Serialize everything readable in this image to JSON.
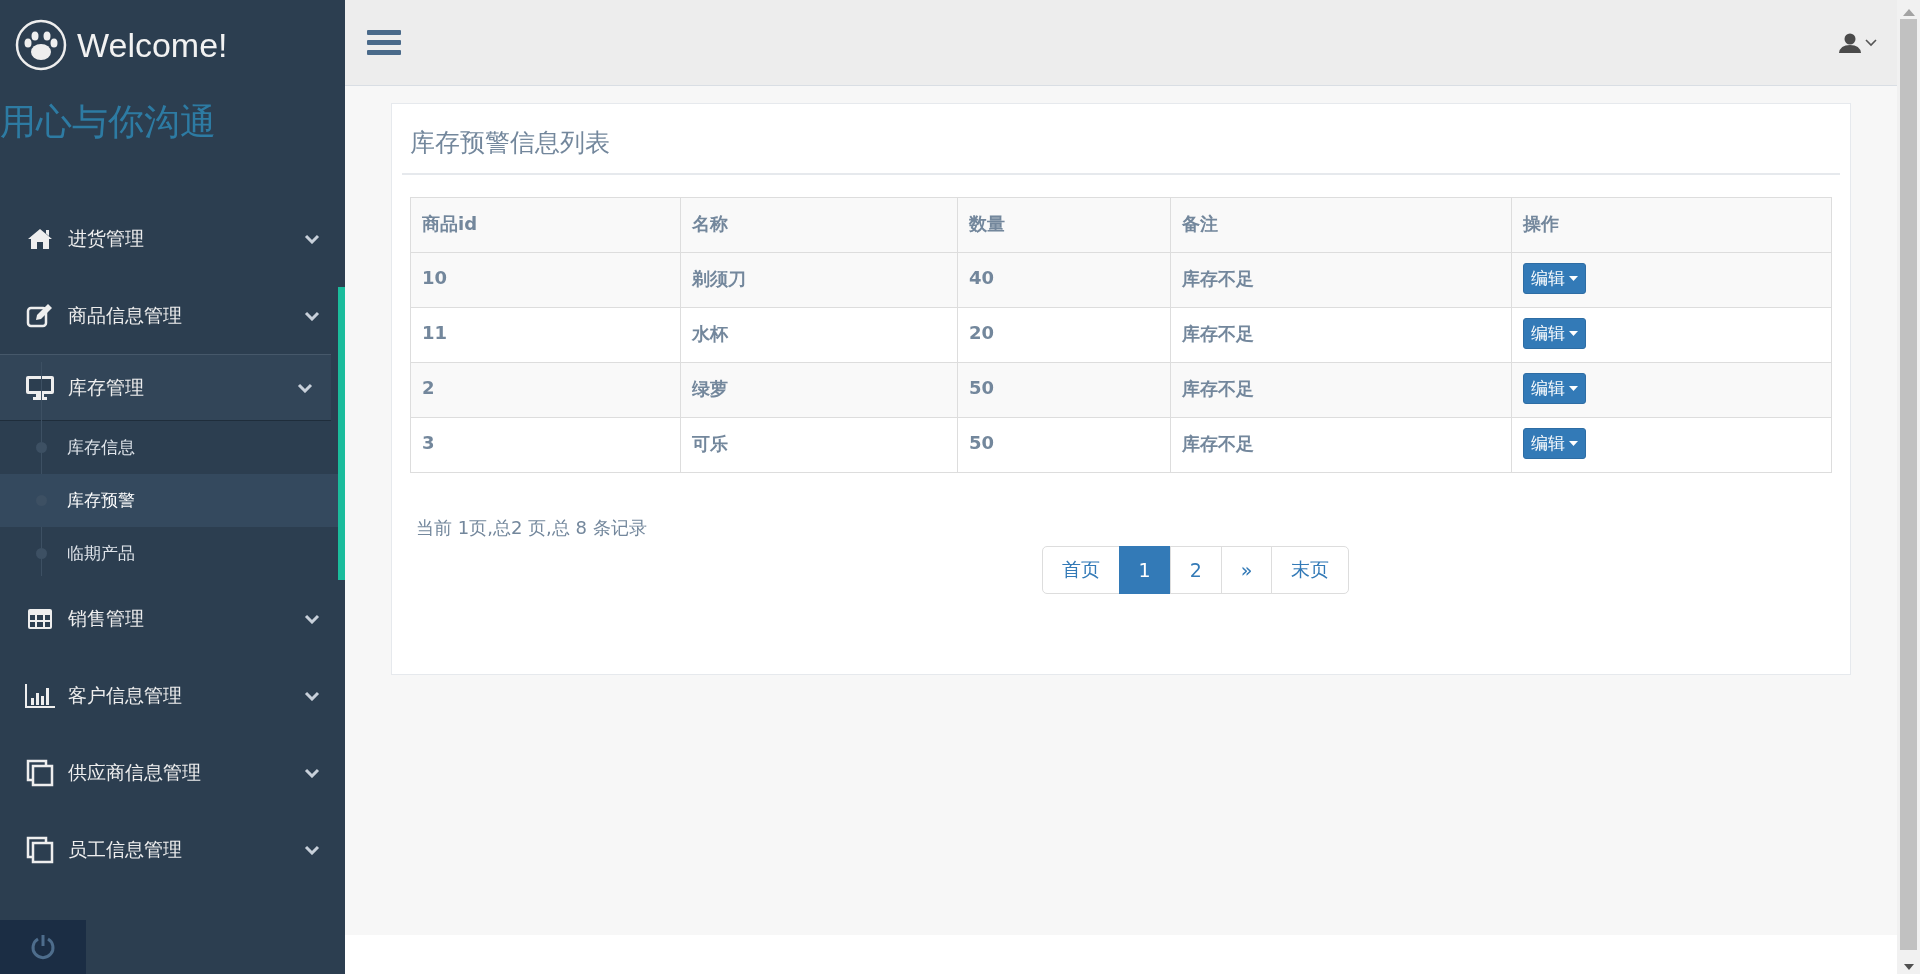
{
  "sidebar": {
    "brand": "Welcome!",
    "slogan": "用心与你沟通",
    "items": [
      {
        "label": "进货管理",
        "expanded": false
      },
      {
        "label": "商品信息管理",
        "expanded": false
      },
      {
        "label": "库存管理",
        "expanded": true,
        "children": [
          {
            "label": "库存信息",
            "selected": false
          },
          {
            "label": "库存预警",
            "selected": true
          },
          {
            "label": "临期产品",
            "selected": false
          }
        ]
      },
      {
        "label": "销售管理",
        "expanded": false
      },
      {
        "label": "客户信息管理",
        "expanded": false
      },
      {
        "label": "供应商信息管理",
        "expanded": false
      },
      {
        "label": "员工信息管理",
        "expanded": false
      }
    ]
  },
  "panel": {
    "title": "库存预警信息列表",
    "table": {
      "columns": [
        "商品id",
        "名称",
        "数量",
        "备注",
        "操作"
      ],
      "rows": [
        {
          "cells": [
            "10",
            "剃须刀",
            "40",
            "库存不足"
          ],
          "action": "编辑"
        },
        {
          "cells": [
            "11",
            "水杯",
            "20",
            "库存不足"
          ],
          "action": "编辑"
        },
        {
          "cells": [
            "2",
            "绿萝",
            "50",
            "库存不足"
          ],
          "action": "编辑"
        },
        {
          "cells": [
            "3",
            "可乐",
            "50",
            "库存不足"
          ],
          "action": "编辑"
        }
      ]
    },
    "page_info": "当前 1页,总2 页,总 8 条记录",
    "pagination": [
      {
        "label": "首页",
        "selected": false
      },
      {
        "label": "1",
        "selected": true
      },
      {
        "label": "2",
        "selected": false
      },
      {
        "label": "»",
        "selected": false
      },
      {
        "label": "末页",
        "selected": false
      }
    ]
  }
}
